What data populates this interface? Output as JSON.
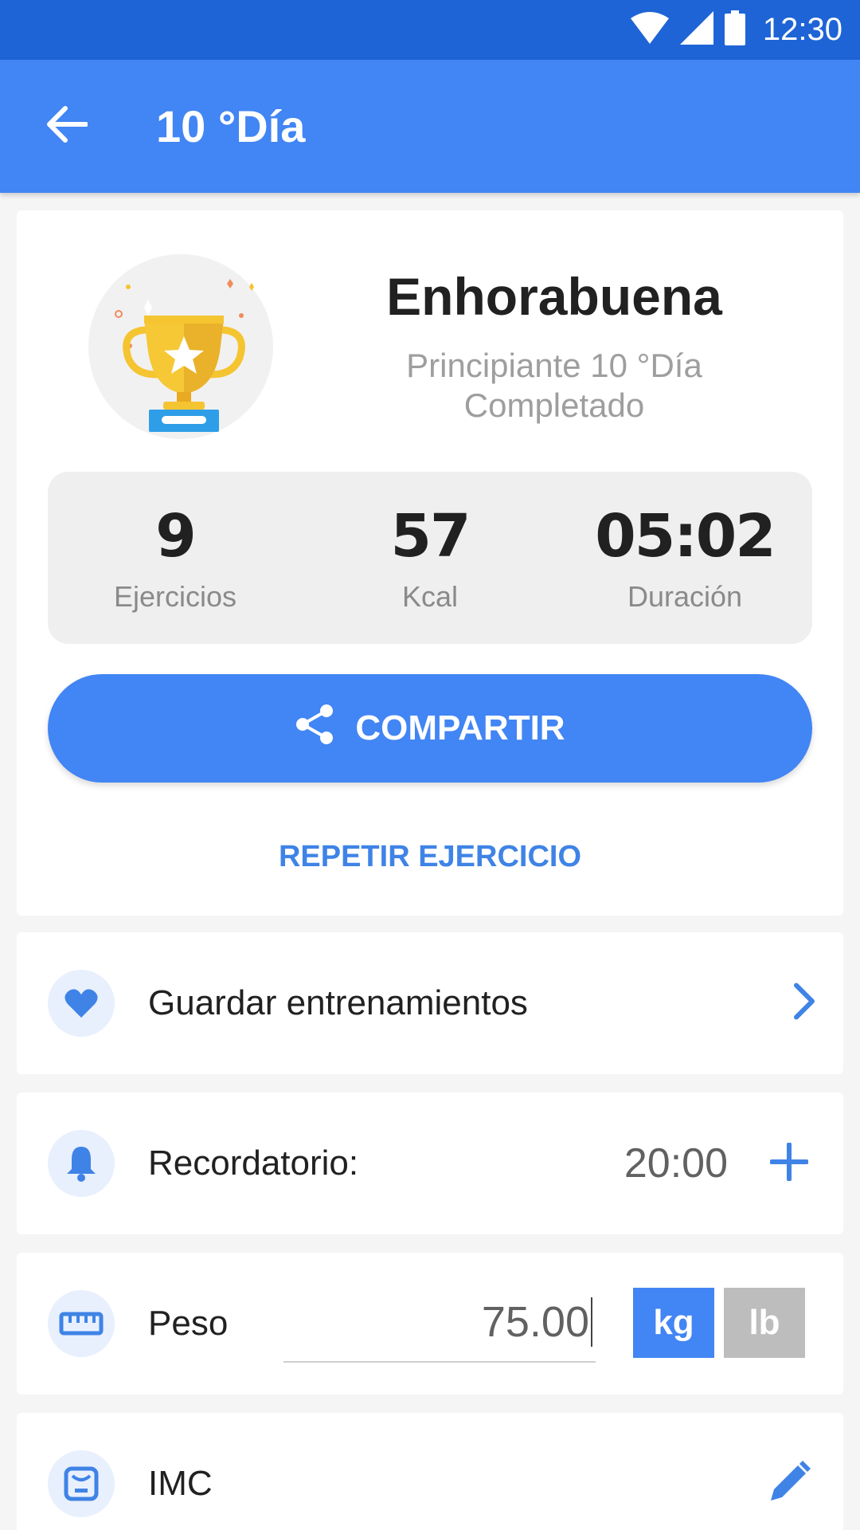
{
  "status_bar": {
    "time": "12:30"
  },
  "app_bar": {
    "title": "10 °Día"
  },
  "hero": {
    "heading": "Enhorabuena",
    "subtitle_line1": "Principiante 10 °Día",
    "subtitle_line2": "Completado"
  },
  "stats": [
    {
      "value": "9",
      "label": "Ejercicios"
    },
    {
      "value": "57",
      "label": "Kcal"
    },
    {
      "value": "05:02",
      "label": "Duración"
    }
  ],
  "share_label": "COMPARTIR",
  "repeat_label": "REPETIR EJERCICIO",
  "save_workouts": {
    "label": "Guardar entrenamientos"
  },
  "reminder": {
    "label": "Recordatorio:",
    "time": "20:00"
  },
  "weight": {
    "label": "Peso",
    "value": "75.00",
    "unit_kg": "kg",
    "unit_lb": "lb",
    "selected_unit": "kg"
  },
  "bmi": {
    "label": "IMC"
  },
  "colors": {
    "primary": "#4285f4",
    "status_bar": "#1e64d6",
    "accent_text": "#3f83e6"
  },
  "icons": [
    "arrow-back-icon",
    "wifi-icon",
    "signal-icon",
    "battery-icon",
    "trophy-icon",
    "share-icon",
    "heart-icon",
    "chevron-right-icon",
    "bell-icon",
    "plus-icon",
    "ruler-icon",
    "scale-icon",
    "pencil-icon"
  ]
}
